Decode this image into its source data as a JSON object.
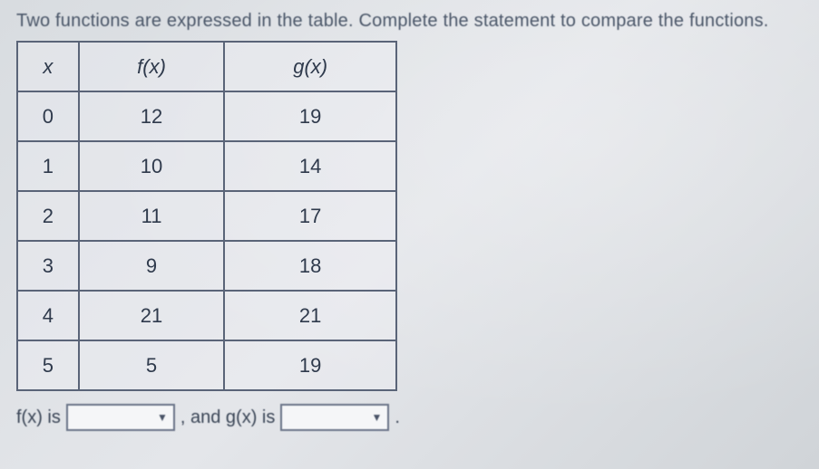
{
  "instruction": "Two functions are expressed in the table. Complete the statement to compare the functions.",
  "table": {
    "headers": {
      "x": "x",
      "fx": "f(x)",
      "gx": "g(x)"
    },
    "rows": [
      {
        "x": "0",
        "fx": "12",
        "gx": "19"
      },
      {
        "x": "1",
        "fx": "10",
        "gx": "14"
      },
      {
        "x": "2",
        "fx": "11",
        "gx": "17"
      },
      {
        "x": "3",
        "fx": "9",
        "gx": "18"
      },
      {
        "x": "4",
        "fx": "21",
        "gx": "21"
      },
      {
        "x": "5",
        "fx": "5",
        "gx": "19"
      }
    ]
  },
  "statement": {
    "fx_label": "f(x) is",
    "fx_value": "",
    "between": ", and g(x) is",
    "gx_value": "",
    "period": "."
  }
}
